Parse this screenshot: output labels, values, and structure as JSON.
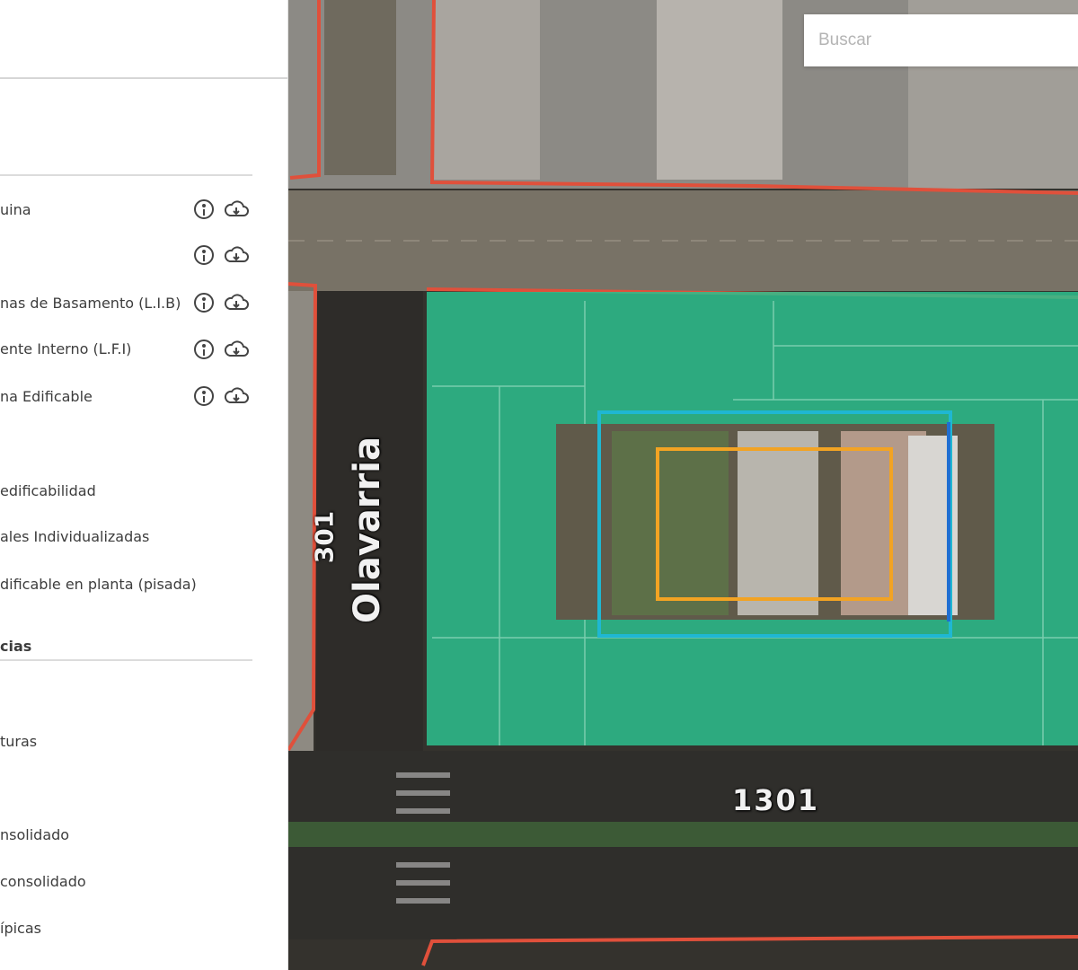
{
  "sidebar": {
    "layer_rows": [
      {
        "label": "uina"
      },
      {
        "label": ""
      },
      {
        "label": "nas de Basamento (L.I.B)"
      },
      {
        "label": "ente Interno (L.F.I)"
      },
      {
        "label": "na Edificable"
      }
    ],
    "edificability_rows": [
      {
        "label": "edificabilidad"
      },
      {
        "label": "ales Individualizadas"
      },
      {
        "label": "dificable en planta (pisada)"
      }
    ],
    "references_title": "cias",
    "reference_rows": [
      {
        "label": ""
      },
      {
        "label": "turas"
      },
      {
        "label": ""
      },
      {
        "label": "nsolidado"
      },
      {
        "label": "consolidado"
      },
      {
        "label": "ípicas"
      }
    ],
    "icons": {
      "info": "info-icon",
      "download": "cloud-download-icon"
    }
  },
  "map": {
    "search": {
      "placeholder": "Buscar",
      "value": ""
    },
    "labels": {
      "street": "Olavarria",
      "left_number": "301",
      "bottom_number": "1301"
    },
    "colors": {
      "parcel_outline": "#e0503b",
      "edificable_fill": "#2dbf8e",
      "cyan_outline": "#1fb7d2",
      "blue_outline": "#1f6fd2",
      "orange_outline": "#f2a323",
      "street": "#787266"
    }
  }
}
